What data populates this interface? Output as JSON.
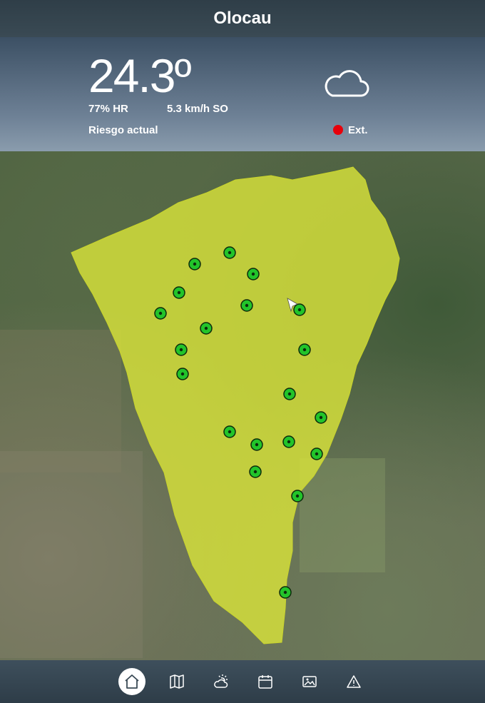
{
  "header": {
    "title": "Olocau"
  },
  "weather": {
    "temperature": "24.3º",
    "humidity": "77% HR",
    "wind": "5.3 km/h SO",
    "risk_label": "Riesgo actual",
    "risk_level": "Ext.",
    "risk_color": "#e8000a",
    "condition_icon": "cloud-icon"
  },
  "map": {
    "area_fill": "#d8e33a",
    "station_color": "#22c42a",
    "stations": 20,
    "location_marker": "navigation-arrow-icon"
  },
  "tabs": [
    {
      "icon": "home-icon",
      "active": true
    },
    {
      "icon": "map-icon",
      "active": false
    },
    {
      "icon": "weather-icon",
      "active": false
    },
    {
      "icon": "calendar-icon",
      "active": false
    },
    {
      "icon": "image-icon",
      "active": false
    },
    {
      "icon": "warning-icon",
      "active": false
    }
  ]
}
